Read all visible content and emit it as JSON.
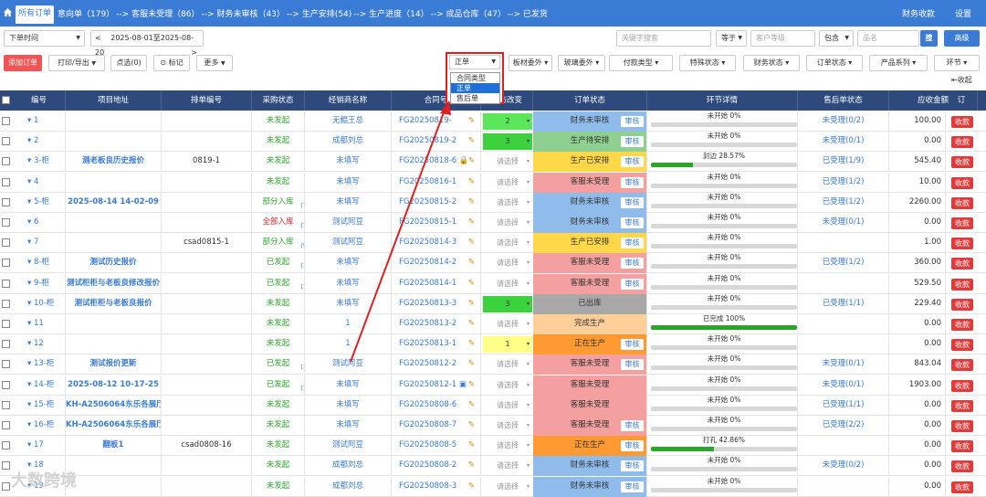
{
  "topbar": {
    "home_tab": "所有订单",
    "flow": [
      "意向单（179）",
      "--> 客服未受理（86）",
      "--> 财务未审核（43）",
      "--> 生产安排(54)",
      "--> 生产进度（14）",
      "--> 成品仓库（47）",
      "--> 已发货"
    ],
    "right": [
      "财务收款",
      "设置"
    ],
    "bg_color": "#3a7bd5"
  },
  "filters": {
    "date_type": "下单时间",
    "date_range": "2025-08-01至2025-08-20",
    "prev": "<",
    "next": ">",
    "keyword_placeholder": "关键字搜索",
    "equal": "等于",
    "level_placeholder": "客户等级",
    "contains": "包含",
    "name_placeholder": "品名",
    "search": "搜",
    "advanced": "高级"
  },
  "toolbar": {
    "add_order": "添加订单",
    "print_export": "打印/导出",
    "click_select": "点选(0)",
    "mark": "标记",
    "more": "更多",
    "dropdowns": [
      "板材委外",
      "玻璃委外",
      "付款类型",
      "特殊状态",
      "财务状态",
      "订单状态",
      "产品系列",
      "环节"
    ],
    "collapse": "收起"
  },
  "contract_dropdown": {
    "selected": "正单",
    "options": [
      "合同类型",
      "正单",
      "售后单"
    ],
    "active_option": "正单"
  },
  "headers": [
    "编号",
    "项目地址",
    "排单编号",
    "采购状态",
    "经销商名称",
    "合同号",
    "状态改变",
    "订单状态",
    "环节详情",
    "售后单状态",
    "应收金额",
    "订"
  ],
  "rows": [
    {
      "no": "1",
      "addr": "",
      "sched": "",
      "purchase": "未发起",
      "pcls": "green",
      "pcount": "",
      "dealer": "无鲲王总",
      "contract": "FG20250819-",
      "extra": "",
      "state": "2",
      "state_color": "#5ce65c",
      "status": "财务未审核",
      "status_color": "#8fbcea",
      "audit": true,
      "progress_text": "未开始 0%",
      "progress": 0,
      "after": "未受理(0/2)",
      "amount": "100.00",
      "recv": "收款"
    },
    {
      "no": "2",
      "addr": "",
      "sched": "",
      "purchase": "未发起",
      "pcls": "green",
      "pcount": "",
      "dealer": "成都刘总",
      "contract": "FG20250819-2",
      "extra": "",
      "state": "3",
      "state_color": "#3dd23d",
      "status": "生产待安排",
      "status_color": "#8fcf8f",
      "audit": true,
      "progress_text": "未开始 0%",
      "progress": 0,
      "after": "未受理(0/1)",
      "amount": "0.00",
      "recv": "收款"
    },
    {
      "no": "3-柜",
      "addr": "测老板良历史报价",
      "sched": "0819-1",
      "purchase": "未发起",
      "pcls": "green",
      "pcount": "",
      "dealer": "未填写",
      "contract": "FG20250818-6",
      "extra": "lock",
      "state": "请选择",
      "state_color": "",
      "status": "生产已安排",
      "status_color": "#ffd84a",
      "audit": true,
      "progress_text": "封边 28.57%",
      "progress": 28.57,
      "after": "已受理(1/9)",
      "amount": "545.40",
      "recv": "收款"
    },
    {
      "no": "4",
      "addr": "",
      "sched": "",
      "purchase": "未发起",
      "pcls": "green",
      "pcount": "",
      "dealer": "未填写",
      "contract": "FG20250816-1",
      "extra": "",
      "state": "请选择",
      "state_color": "",
      "status": "客服未受理",
      "status_color": "#f5a0a0",
      "audit": true,
      "progress_text": "未开始 0%",
      "progress": 0,
      "after": "已受理(1/2)",
      "amount": "10.00",
      "recv": "收款"
    },
    {
      "no": "5-柜",
      "addr": "2025-08-14 14-02-09",
      "sched": "",
      "purchase": "部分入库",
      "pcls": "green",
      "pcount": "(7)",
      "dealer": "未填写",
      "contract": "FG20250815-2",
      "extra": "",
      "state": "请选择",
      "state_color": "",
      "status": "财务未审核",
      "status_color": "#8fbcea",
      "audit": true,
      "progress_text": "未开始 0%",
      "progress": 0,
      "after": "已受理(1/2)",
      "amount": "2260.00",
      "recv": "收款"
    },
    {
      "no": "6",
      "addr": "",
      "sched": "",
      "purchase": "全部入库",
      "pcls": "red",
      "pcount": "(1)",
      "dealer": "测试阿豆",
      "contract": "FG20250815-1",
      "extra": "",
      "state": "请选择",
      "state_color": "",
      "status": "财务未审核",
      "status_color": "#8fbcea",
      "audit": true,
      "progress_text": "未开始 0%",
      "progress": 0,
      "after": "未受理(0/1)",
      "amount": "0.00",
      "recv": "收款"
    },
    {
      "no": "7",
      "addr": "",
      "sched": "csad0815-1",
      "purchase": "部分入库",
      "pcls": "green",
      "pcount": "(9)",
      "dealer": "测试阿豆",
      "contract": "FG20250814-3",
      "extra": "",
      "state": "请选择",
      "state_color": "",
      "status": "生产已安排",
      "status_color": "#ffd84a",
      "audit": true,
      "progress_text": "未开始 0%",
      "progress": 0,
      "after": "",
      "amount": "1.00",
      "recv": "收款"
    },
    {
      "no": "8-柜",
      "addr": "测试历史报价",
      "sched": "",
      "purchase": "已发起",
      "pcls": "green",
      "pcount": "(1)",
      "dealer": "未填写",
      "contract": "FG20250814-2",
      "extra": "",
      "state": "请选择",
      "state_color": "",
      "status": "客服未受理",
      "status_color": "#f5a0a0",
      "audit": true,
      "progress_text": "未开始 0%",
      "progress": 0,
      "after": "已受理(1/2)",
      "amount": "360.00",
      "recv": "收款"
    },
    {
      "no": "9-柜",
      "addr": "测试柜柜与老板良修改报价",
      "sched": "",
      "purchase": "已发起",
      "pcls": "green",
      "pcount": "(1)",
      "dealer": "未填写",
      "contract": "FG20250814-1",
      "extra": "",
      "state": "请选择",
      "state_color": "",
      "status": "客服未受理",
      "status_color": "#f5a0a0",
      "audit": true,
      "progress_text": "未开始 0%",
      "progress": 0,
      "after": "",
      "amount": "529.50",
      "recv": "收款"
    },
    {
      "no": "10-柜",
      "addr": "测试柜柜与老板良报价",
      "sched": "",
      "purchase": "未发起",
      "pcls": "green",
      "pcount": "",
      "dealer": "未填写",
      "contract": "FG20250813-3",
      "extra": "",
      "state": "3",
      "state_color": "#3dd23d",
      "status": "已出库",
      "status_color": "#a8a8a8",
      "audit": false,
      "progress_text": "未开始 0%",
      "progress": 0,
      "after": "已受理(1/1)",
      "amount": "229.40",
      "recv": "收款"
    },
    {
      "no": "11",
      "addr": "",
      "sched": "",
      "purchase": "未发起",
      "pcls": "green",
      "pcount": "",
      "dealer": "1",
      "contract": "FG20250813-2",
      "extra": "",
      "state": "请选择",
      "state_color": "",
      "status": "完成生产",
      "status_color": "#ffcf9a",
      "audit": false,
      "progress_text": "已完成 100%",
      "progress": 100,
      "after": "",
      "amount": "0.00",
      "recv": "收款"
    },
    {
      "no": "12",
      "addr": "",
      "sched": "",
      "purchase": "未发起",
      "pcls": "green",
      "pcount": "",
      "dealer": "1",
      "contract": "FG20250813-1",
      "extra": "",
      "state": "1",
      "state_color": "#ffff88",
      "status": "正在生产",
      "status_color": "#ff9a33",
      "audit": true,
      "progress_text": "未开始 0%",
      "progress": 0,
      "after": "",
      "amount": "0.00",
      "recv": "收款"
    },
    {
      "no": "13-柜",
      "addr": "测试报价更新",
      "sched": "",
      "purchase": "已发起",
      "pcls": "green",
      "pcount": "(1)",
      "dealer": "测试阿豆",
      "contract": "FG20250812-2",
      "extra": "",
      "state": "请选择",
      "state_color": "",
      "status": "客服未受理",
      "status_color": "#f5a0a0",
      "audit": true,
      "progress_text": "未开始 0%",
      "progress": 0,
      "after": "未受理(0/1)",
      "amount": "843.04",
      "recv": "收款"
    },
    {
      "no": "14-柜",
      "addr": "2025-08-12 10-17-25",
      "sched": "",
      "purchase": "已发起",
      "pcls": "green",
      "pcount": "(3)",
      "dealer": "未填写",
      "contract": "FG20250812-1",
      "extra": "box",
      "state": "请选择",
      "state_color": "",
      "status": "客服未受理",
      "status_color": "#f5a0a0",
      "audit": false,
      "progress_text": "未开始 0%",
      "progress": 0,
      "after": "未受理(0/1)",
      "amount": "1903.00",
      "recv": "收款"
    },
    {
      "no": "15-柜",
      "addr": "KH-A2506064东乐各展厅",
      "sched": "",
      "purchase": "未发起",
      "pcls": "green",
      "pcount": "",
      "dealer": "未填写",
      "contract": "FG20250808-6",
      "extra": "",
      "state": "请选择",
      "state_color": "",
      "status": "客服未受理",
      "status_color": "#f5a0a0",
      "audit": false,
      "progress_text": "未开始 0%",
      "progress": 0,
      "after": "已受理(1/1)",
      "amount": "0.00",
      "recv": "收款"
    },
    {
      "no": "16-柜",
      "addr": "KH-A2506064东乐各展厅",
      "sched": "",
      "purchase": "未发起",
      "pcls": "green",
      "pcount": "",
      "dealer": "未填写",
      "contract": "FG20250808-7",
      "extra": "",
      "state": "请选择",
      "state_color": "",
      "status": "客服未受理",
      "status_color": "#f5a0a0",
      "audit": true,
      "progress_text": "未开始 0%",
      "progress": 0,
      "after": "已受理(2/2)",
      "amount": "0.00",
      "recv": "收款"
    },
    {
      "no": "17",
      "addr": "翻板1",
      "sched": "csad0808-16",
      "purchase": "未发起",
      "pcls": "green",
      "pcount": "",
      "dealer": "测试阿豆",
      "contract": "FG20250808-5",
      "extra": "",
      "state": "请选择",
      "state_color": "",
      "status": "正在生产",
      "status_color": "#ff9a33",
      "audit": true,
      "progress_text": "打孔 42.86%",
      "progress": 42.86,
      "after": "",
      "amount": "0.00",
      "recv": "收款"
    },
    {
      "no": "18",
      "addr": "",
      "sched": "",
      "purchase": "未发起",
      "pcls": "green",
      "pcount": "",
      "dealer": "成都刘总",
      "contract": "FG20250808-2",
      "extra": "",
      "state": "请选择",
      "state_color": "",
      "status": "财务未审核",
      "status_color": "#8fbcea",
      "audit": true,
      "progress_text": "未开始 0%",
      "progress": 0,
      "after": "未受理(0/2)",
      "amount": "0.00",
      "recv": "收款"
    },
    {
      "no": "19",
      "addr": "",
      "sched": "",
      "purchase": "未发起",
      "pcls": "green",
      "pcount": "",
      "dealer": "成都刘总",
      "contract": "FG20250808-3",
      "extra": "",
      "state": "请选择",
      "state_color": "",
      "status": "财务未审核",
      "status_color": "#8fbcea",
      "audit": true,
      "progress_text": "未开始 0%",
      "progress": 0,
      "after": "",
      "amount": "0.00",
      "recv": "收款"
    }
  ],
  "audit_label": "审核",
  "watermark": "大数跨境"
}
